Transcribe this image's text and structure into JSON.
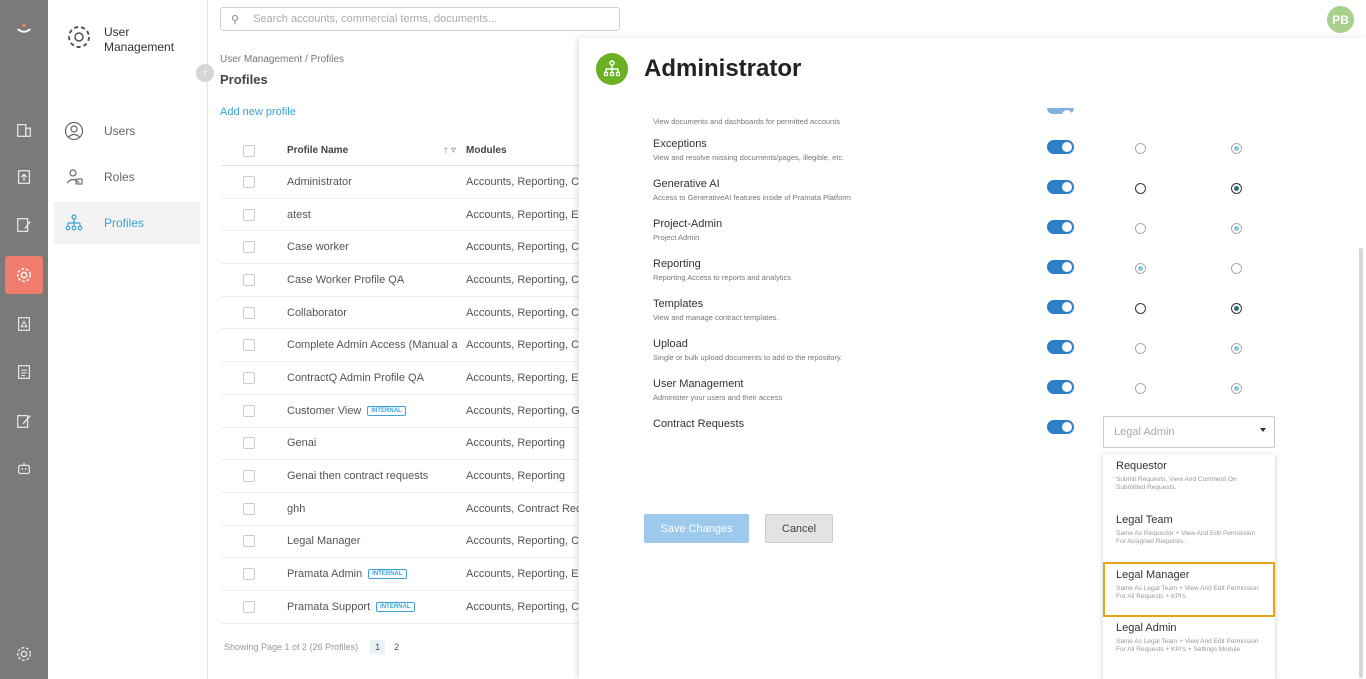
{
  "search": {
    "placeholder": "Search accounts, commercial terms, documents..."
  },
  "user": {
    "initials": "PB"
  },
  "sidebar": {
    "title": "User Management",
    "items": [
      {
        "label": "Users"
      },
      {
        "label": "Roles"
      },
      {
        "label": "Profiles"
      }
    ]
  },
  "breadcrumb": "User Management / Profiles",
  "page_title": "Profiles",
  "add_profile": "Add new profile",
  "table": {
    "headers": {
      "name": "Profile Name",
      "modules": "Modules"
    },
    "rows": [
      {
        "name": "Administrator",
        "modules": "Accounts, Reporting, C",
        "badge": ""
      },
      {
        "name": "atest",
        "modules": "Accounts, Reporting, Ex",
        "badge": ""
      },
      {
        "name": "Case worker",
        "modules": "Accounts, Reporting, C",
        "badge": ""
      },
      {
        "name": "Case Worker Profile QA",
        "modules": "Accounts, Reporting, C",
        "badge": ""
      },
      {
        "name": "Collaborator",
        "modules": "Accounts, Reporting, C",
        "badge": ""
      },
      {
        "name": "Complete Admin Access (Manual a",
        "modules": "Accounts, Reporting, C",
        "badge": ""
      },
      {
        "name": "ContractQ Admin Profile QA",
        "modules": "Accounts, Reporting, Ex",
        "badge": ""
      },
      {
        "name": "Customer View",
        "modules": "Accounts, Reporting, G",
        "badge": "INTERNAL"
      },
      {
        "name": "Genai",
        "modules": "Accounts, Reporting",
        "badge": ""
      },
      {
        "name": "Genai then contract requests",
        "modules": "Accounts, Reporting",
        "badge": ""
      },
      {
        "name": "ghh",
        "modules": "Accounts, Contract Rec",
        "badge": ""
      },
      {
        "name": "Legal Manager",
        "modules": "Accounts, Reporting, C",
        "badge": ""
      },
      {
        "name": "Pramata Admin",
        "modules": "Accounts, Reporting, Ex",
        "badge": "INTERNAL"
      },
      {
        "name": "Pramata Support",
        "modules": "Accounts, Reporting, C",
        "badge": "INTERNAL"
      }
    ]
  },
  "pager": {
    "text": "Showing Page 1 of 2 (26 Profiles)",
    "pages": [
      "1",
      "2"
    ]
  },
  "panel": {
    "title": "Administrator",
    "partial_desc": "View documents and dashboards for permitted accounts",
    "modules": [
      {
        "name": "Exceptions",
        "desc": "View and resolve missing documents/pages, illegible, etc.",
        "r1": "empty",
        "r2": "selected"
      },
      {
        "name": "Generative AI",
        "desc": "Access to GenerativeAI features inside of Pramata Platform",
        "r1": "empty-dark",
        "r2": "selected-dark"
      },
      {
        "name": "Project-Admin",
        "desc": "Project Admin",
        "r1": "empty",
        "r2": "selected"
      },
      {
        "name": "Reporting",
        "desc": "Reporting Access to reports and analytics",
        "r1": "selected",
        "r2": "empty"
      },
      {
        "name": "Templates",
        "desc": "View and manage contract templates.",
        "r1": "empty-dark",
        "r2": "selected-dark"
      },
      {
        "name": "Upload",
        "desc": "Single or bulk upload documents to add to the repository.",
        "r1": "empty",
        "r2": "selected"
      },
      {
        "name": "User Management",
        "desc": "Administer your users and their access",
        "r1": "empty",
        "r2": "selected"
      },
      {
        "name": "Contract Requests",
        "desc": "",
        "r1": "",
        "r2": ""
      }
    ],
    "dropdown": {
      "value": "Legal Admin"
    },
    "options": [
      {
        "name": "Requestor",
        "desc": "Submit Requests, View And Comment On Submitted Requests."
      },
      {
        "name": "Legal Team",
        "desc": "Same As Requestor + View And Edit Permission For Assigned Requests."
      },
      {
        "name": "Legal Manager",
        "desc": "Same As Legal Team + View And Edit Permission For All Requests + KPI's"
      },
      {
        "name": "Legal Admin",
        "desc": "Same As Legal Team + View And Edit Permission For All Requests + KPI's + Settings Module"
      }
    ],
    "save_label": "Save Changes",
    "cancel_label": "Cancel"
  }
}
